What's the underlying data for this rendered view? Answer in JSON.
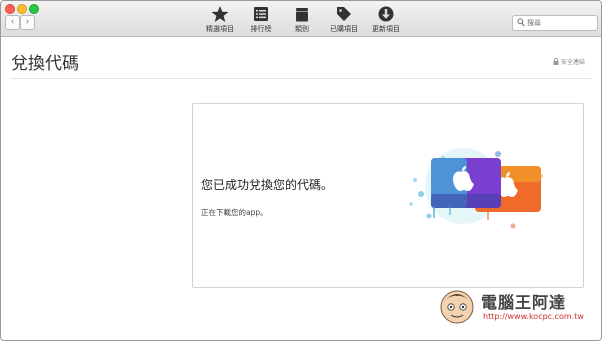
{
  "window": {
    "traffic_lights": [
      "close",
      "minimize",
      "zoom"
    ]
  },
  "toolbar": {
    "nav": {
      "back_icon": "chevron-left-icon",
      "forward_icon": "chevron-right-icon"
    },
    "items": [
      {
        "label": "精選項目",
        "icon": "star-icon"
      },
      {
        "label": "排行榜",
        "icon": "list-icon"
      },
      {
        "label": "類別",
        "icon": "category-icon"
      },
      {
        "label": "已購項目",
        "icon": "tag-icon"
      },
      {
        "label": "更新項目",
        "icon": "download-icon"
      }
    ],
    "search": {
      "placeholder": "搜尋",
      "value": ""
    }
  },
  "page": {
    "title": "兌換代碼",
    "secure_label": "安全連結"
  },
  "card": {
    "success_message": "您已成功兌換您的代碼。",
    "status": "正在下載您的app。",
    "image": "itunes-gift-card-illustration"
  },
  "watermark": {
    "title": "電腦王阿達",
    "url": "http://www.kocpc.com.tw"
  },
  "colors": {
    "close": "#ff5f57",
    "minimize": "#febc2e",
    "zoom": "#28c840",
    "card_purple": "#7a3fd0",
    "card_orange": "#f06a2a"
  }
}
